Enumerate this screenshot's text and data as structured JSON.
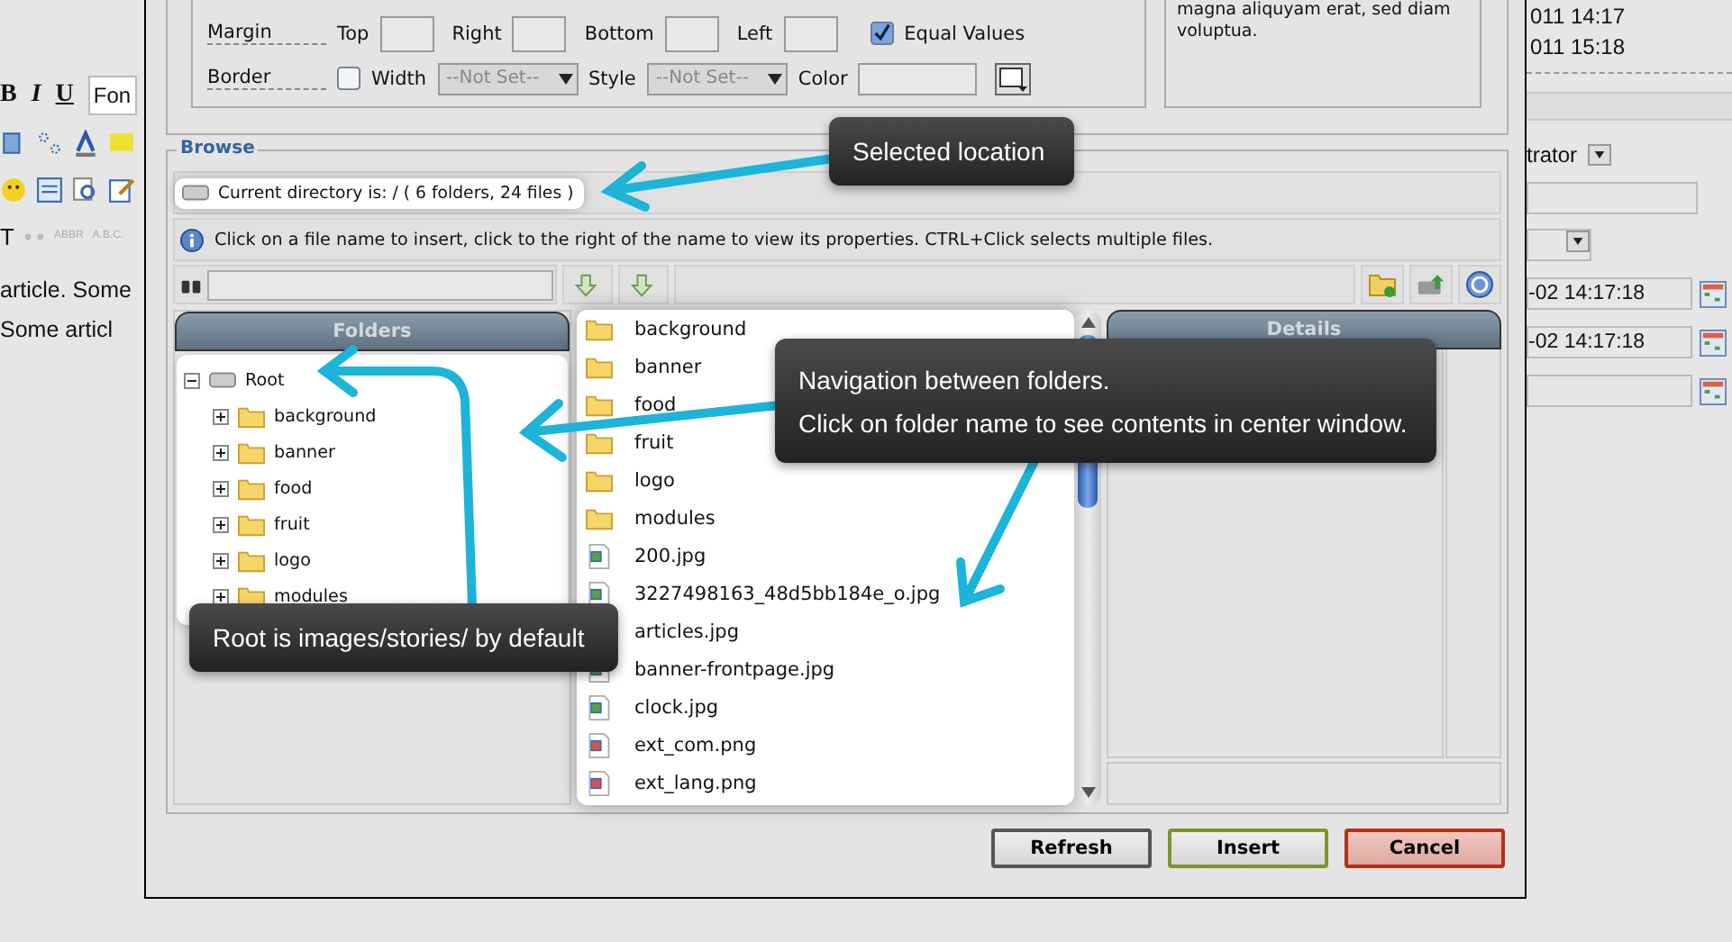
{
  "left_editor": {
    "format_buttons": [
      "B",
      "I",
      "U"
    ],
    "font_select": "Fon",
    "tag_buttons": [
      "T",
      "ABBR",
      "A.B.C."
    ],
    "text_lines": [
      "article. Some",
      "Some articl"
    ]
  },
  "style_panel": {
    "margin": {
      "label": "Margin",
      "fields": [
        {
          "label": "Top"
        },
        {
          "label": "Right"
        },
        {
          "label": "Bottom"
        },
        {
          "label": "Left"
        }
      ],
      "equal_values": {
        "label": "Equal Values",
        "checked": true
      }
    },
    "border": {
      "label": "Border",
      "width": {
        "label": "Width",
        "checked": false,
        "value": "--Not Set--",
        "disabled": true
      },
      "style": {
        "label": "Style",
        "value": "--Not Set--",
        "disabled": true
      },
      "color": {
        "label": "Color"
      }
    },
    "preview_text": "magna aliquyam erat, sed diam voluptua."
  },
  "browse": {
    "legend": "Browse",
    "current_directory": "Current directory is: / ( 6 folders, 24 files )",
    "info": "Click on a file name to insert, click to the right of the name to view its properties. CTRL+Click selects multiple files.",
    "folders": {
      "title": "Folders",
      "root": {
        "label": "Root",
        "expanded": true,
        "children": [
          {
            "label": "background",
            "expanded": false
          },
          {
            "label": "banner",
            "expanded": false
          },
          {
            "label": "food",
            "expanded": false
          },
          {
            "label": "fruit",
            "expanded": false
          },
          {
            "label": "logo",
            "expanded": false
          },
          {
            "label": "modules",
            "expanded": false
          }
        ]
      }
    },
    "files": [
      {
        "name": "background",
        "kind": "folder"
      },
      {
        "name": "banner",
        "kind": "folder"
      },
      {
        "name": "food",
        "kind": "folder"
      },
      {
        "name": "fruit",
        "kind": "folder"
      },
      {
        "name": "logo",
        "kind": "folder"
      },
      {
        "name": "modules",
        "kind": "folder"
      },
      {
        "name": "200.jpg",
        "kind": "jpg"
      },
      {
        "name": "3227498163_48d5bb184e_o.jpg",
        "kind": "jpg"
      },
      {
        "name": "articles.jpg",
        "kind": "jpg"
      },
      {
        "name": "banner-frontpage.jpg",
        "kind": "jpg"
      },
      {
        "name": "clock.jpg",
        "kind": "jpg"
      },
      {
        "name": "ext_com.png",
        "kind": "png"
      },
      {
        "name": "ext_lang.png",
        "kind": "png"
      }
    ],
    "details": {
      "title": "Details"
    }
  },
  "buttons": [
    {
      "label": "Refresh",
      "kind": "neutral"
    },
    {
      "label": "Insert",
      "kind": "confirm"
    },
    {
      "label": "Cancel",
      "kind": "danger"
    }
  ],
  "right_panel": {
    "dates": [
      "011 14:17",
      "011 15:18"
    ],
    "author_select": "trator",
    "date_fields": [
      "-02 14:17:18",
      "-02 14:17:18"
    ]
  },
  "callouts": [
    {
      "lines": [
        "Selected location"
      ]
    },
    {
      "lines": [
        "Navigation between folders.",
        "Click on folder name to see contents in center window."
      ]
    },
    {
      "lines": [
        "Root is images/stories/ by default"
      ]
    }
  ]
}
